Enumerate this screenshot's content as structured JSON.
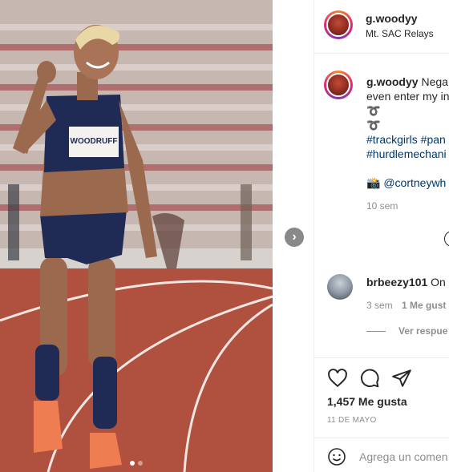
{
  "post": {
    "username": "g.woodyy",
    "location": "Mt. SAC Relays",
    "photo_bib_text": "WOODRUFF",
    "caption": {
      "username": "g.woodyy",
      "line1": "Nega",
      "line2": "even enter my in",
      "icon_lines": [
        "➰",
        "➰"
      ],
      "hashtag_line1": "#trackgirls #pan",
      "hashtag_line2": "#hurdlemechani",
      "credit": "📸 @cortneywh",
      "time": "10 sem"
    },
    "comment": {
      "username": "brbeezy101",
      "text": "On",
      "time": "3 sem",
      "likes_label": "1 Me gust",
      "replies_label": "Ver respue"
    },
    "likes": "1,457 Me gusta",
    "date": "11 DE MAYO",
    "add_comment_placeholder": "Agrega un comen"
  },
  "icons": {
    "next": "chevron-right-icon",
    "like": "heart-icon",
    "comment": "comment-icon",
    "share": "send-icon",
    "emoji": "smiley-icon"
  },
  "colors": {
    "hashtag": "#00376b",
    "muted": "#8e8e8e",
    "text": "#262626"
  }
}
